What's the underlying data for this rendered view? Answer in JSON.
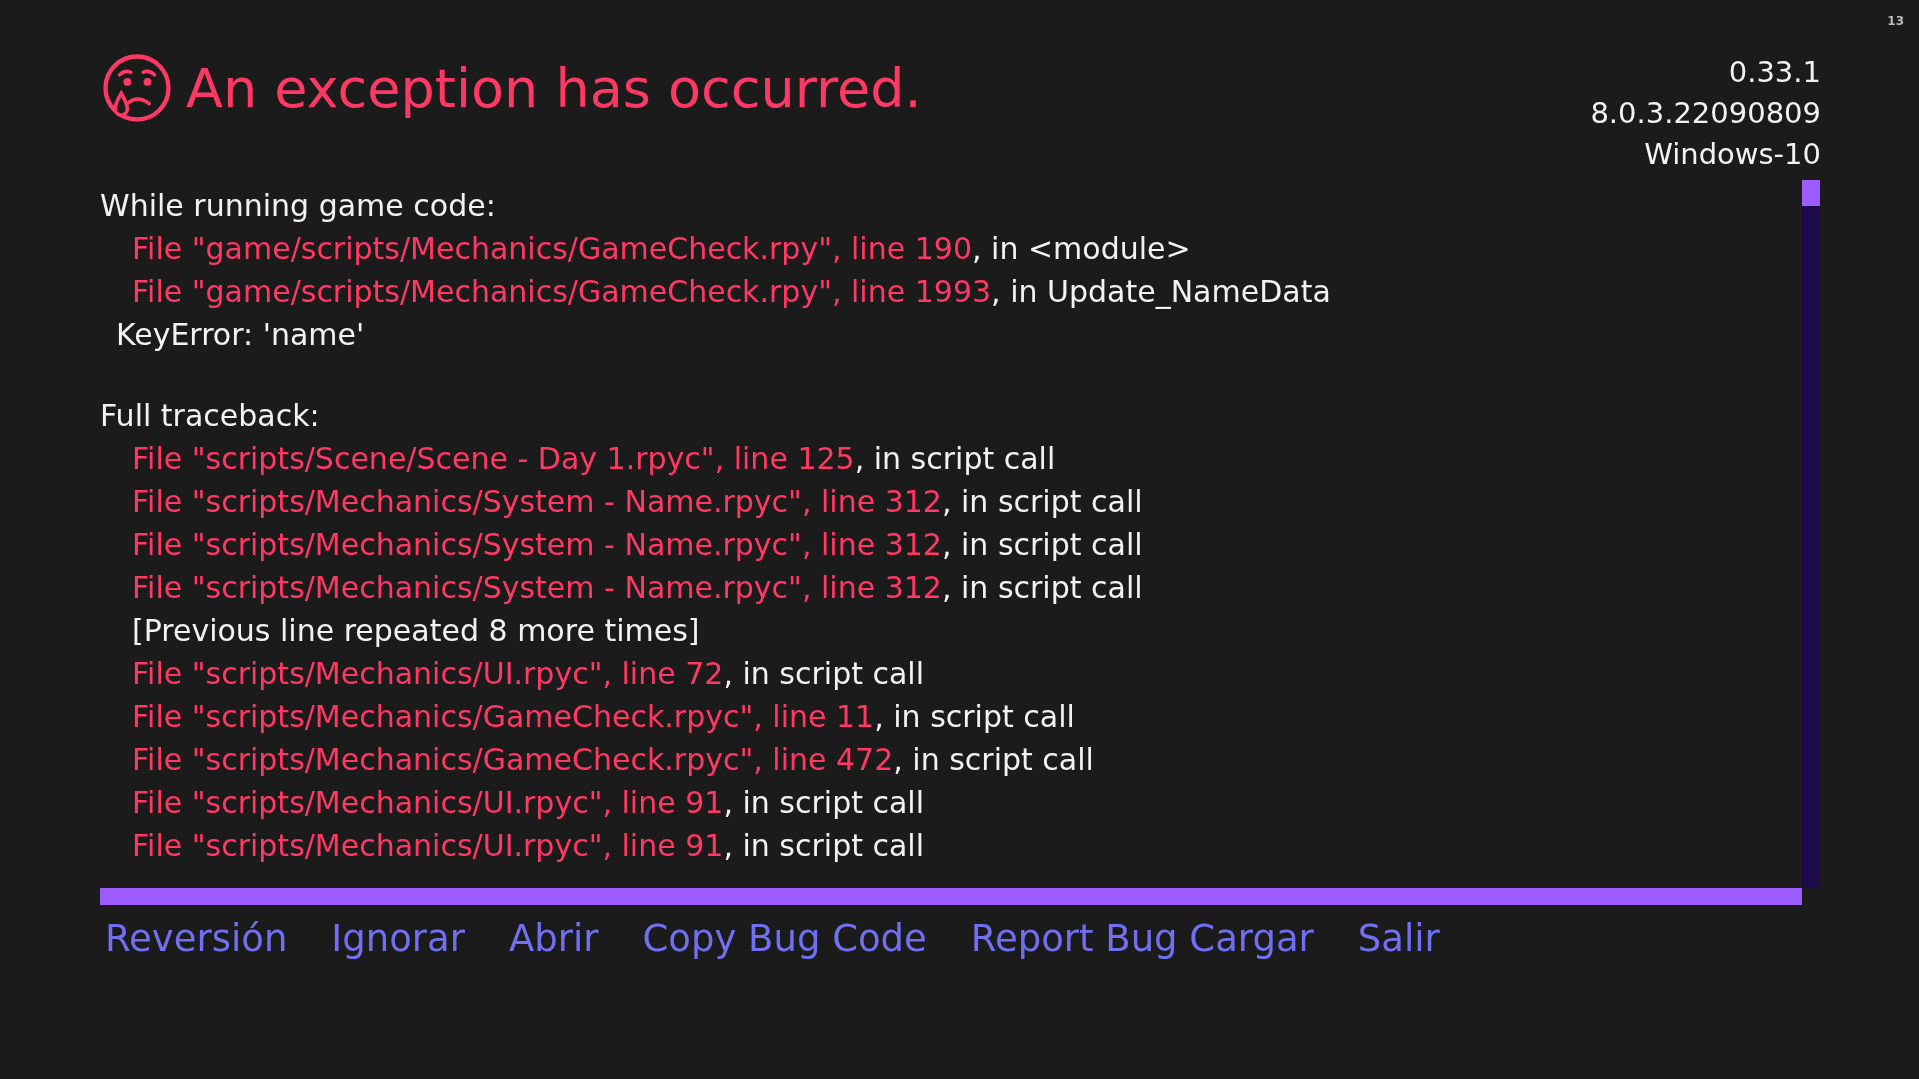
{
  "corner_label": "13",
  "title": "An exception has occurred.",
  "version_lines": [
    "0.33.1",
    "8.0.3.22090809",
    "Windows-10"
  ],
  "sections": [
    {
      "heading": "While running game code:",
      "lines": [
        {
          "kind": "frame",
          "location": "File \"game/scripts/Mechanics/GameCheck.rpy\", line 190",
          "context": ", in <module>"
        },
        {
          "kind": "frame",
          "location": "File \"game/scripts/Mechanics/GameCheck.rpy\", line 1993",
          "context": ", in Update_NameData"
        },
        {
          "kind": "error",
          "text": "KeyError: 'name'"
        }
      ]
    },
    {
      "heading": "Full traceback:",
      "lines": [
        {
          "kind": "frame",
          "location": "File \"scripts/Scene/Scene - Day 1.rpyc\", line 125",
          "context": ", in script call"
        },
        {
          "kind": "frame",
          "location": "File \"scripts/Mechanics/System - Name.rpyc\", line 312",
          "context": ", in script call"
        },
        {
          "kind": "frame",
          "location": "File \"scripts/Mechanics/System - Name.rpyc\", line 312",
          "context": ", in script call"
        },
        {
          "kind": "frame",
          "location": "File \"scripts/Mechanics/System - Name.rpyc\", line 312",
          "context": ", in script call"
        },
        {
          "kind": "note",
          "text": "[Previous line repeated 8 more times]"
        },
        {
          "kind": "frame",
          "location": "File \"scripts/Mechanics/UI.rpyc\", line 72",
          "context": ", in script call"
        },
        {
          "kind": "frame",
          "location": "File \"scripts/Mechanics/GameCheck.rpyc\", line 11",
          "context": ", in script call"
        },
        {
          "kind": "frame",
          "location": "File \"scripts/Mechanics/GameCheck.rpyc\", line 472",
          "context": ", in script call"
        },
        {
          "kind": "frame",
          "location": "File \"scripts/Mechanics/UI.rpyc\", line 91",
          "context": ", in script call"
        },
        {
          "kind": "frame",
          "location": "File \"scripts/Mechanics/UI.rpyc\", line 91",
          "context": ", in script call"
        }
      ]
    }
  ],
  "buttons": [
    "Reversión",
    "Ignorar",
    "Abrir",
    "Copy Bug Code",
    "Report Bug Cargar",
    "Salir"
  ]
}
